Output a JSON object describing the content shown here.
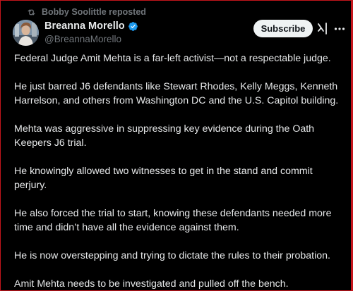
{
  "repost": {
    "text": "Bobby Soolittle reposted",
    "icon": "repost-icon"
  },
  "author": {
    "display_name": "Breanna Morello",
    "handle": "@BreannaMorello",
    "verified_icon": "verified-badge-icon",
    "verified_color": "#1d9bf0"
  },
  "actions": {
    "subscribe_label": "Subscribe",
    "grok_icon": "grok-icon",
    "more_icon": "more-options-icon"
  },
  "post": {
    "paragraphs": [
      "Federal Judge Amit Mehta is a far-left activist—not a respectable judge.",
      "He just barred J6 defendants like Stewart Rhodes, Kelly Meggs, Kenneth Harrelson, and others from Washington DC and the U.S. Capitol building.",
      "Mehta was aggressive in suppressing key evidence during the Oath Keepers J6 trial.",
      "He knowingly allowed two witnesses to get in the stand and commit perjury.",
      "He also forced the trial to start, knowing these defendants needed more time and didn’t have all the evidence against them.",
      "He is now overstepping and trying to dictate the rules to their probation.",
      "Amit Mehta needs to be investigated and pulled off the bench."
    ]
  },
  "colors": {
    "background": "#000000",
    "text_primary": "#e7e9ea",
    "text_secondary": "#71767b",
    "button_bg": "#eff3f4",
    "button_text": "#0f1419",
    "frame_border": "#c4161c"
  }
}
